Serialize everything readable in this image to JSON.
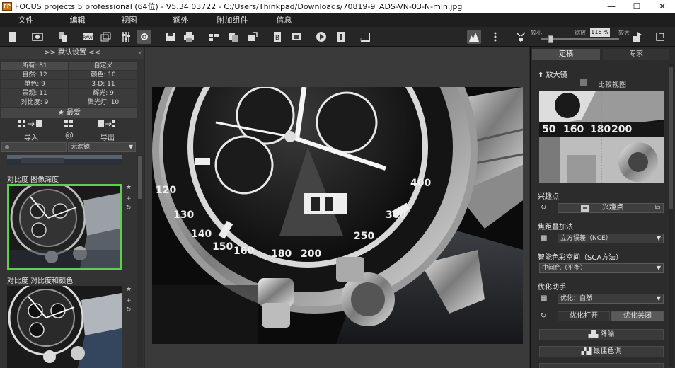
{
  "titlebar": {
    "app_icon_text": "FP",
    "title": "FOCUS projects 5 professional (64位) - V5.34.03722 - C:/Users/Thinkpad/Downloads/70819-9_ADS-VN-03-N-min.jpg",
    "minimize": "—",
    "maximize": "☐",
    "close": "✕"
  },
  "menu": [
    "文件",
    "编辑",
    "视图",
    "额外",
    "附加组件",
    "信息"
  ],
  "toolbar": {
    "zoom_small_label": "较小",
    "zoom_label": "缩放",
    "zoom_value": "116 %",
    "zoom_large_label": "较大",
    "zoom_fraction": 0.1
  },
  "left_panel": {
    "title": ">> 默认设置 <<",
    "close": "x",
    "categories": [
      [
        "所有: 81",
        "自定义"
      ],
      [
        "自然: 12",
        "颜色: 10"
      ],
      [
        "单色: 9",
        "3-D: 11"
      ],
      [
        "景观: 11",
        "辉光: 9"
      ],
      [
        "对比度: 9",
        "聚光灯: 10"
      ]
    ],
    "favorites": "★ 最爱",
    "import_label": "导入",
    "at_label": "@",
    "export_label": "导出",
    "filter_value": "无滤镜",
    "presets": [
      {
        "title": "对比度 图像深度"
      },
      {
        "title": "对比度 对比度和颜色"
      }
    ]
  },
  "right_panel": {
    "tabs": [
      "定稿",
      "专家"
    ],
    "magnifier_title": "放大镜",
    "compare_view": "比较视图",
    "interest_title": "兴趣点",
    "interest_button": "兴趣点",
    "focus_stack_title": "焦距叠加法",
    "focus_stack_value": "立方误差（NCE）",
    "color_space_title": "智能色彩空间（SCA方法）",
    "color_space_value": "中间色（平衡）",
    "optimizer_title": "优化助手",
    "optimizer_value": "优化：自然",
    "opt_on": "优化打开",
    "opt_off": "优化关闭",
    "denoise": "降噪",
    "best_tone": "最佳色调"
  }
}
